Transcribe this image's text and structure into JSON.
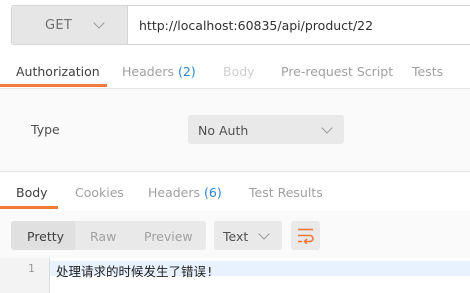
{
  "request": {
    "method": "GET",
    "url": "http://localhost:60835/api/product/22"
  },
  "request_tabs": {
    "authorization": "Authorization",
    "headers": "Headers",
    "headers_count": "(2)",
    "body": "Body",
    "pre_request": "Pre-request Script",
    "tests": "Tests"
  },
  "auth": {
    "type_label": "Type",
    "type_value": "No Auth"
  },
  "response_tabs": {
    "body": "Body",
    "cookies": "Cookies",
    "headers": "Headers",
    "headers_count": "(6)",
    "test_results": "Test Results"
  },
  "response_view": {
    "pretty": "Pretty",
    "raw": "Raw",
    "preview": "Preview",
    "format": "Text"
  },
  "response_body": {
    "line_number": "1",
    "line_text": "处理请求的时候发生了错误!"
  },
  "colors": {
    "accent": "#f27a3a",
    "count": "#2c83d6"
  }
}
